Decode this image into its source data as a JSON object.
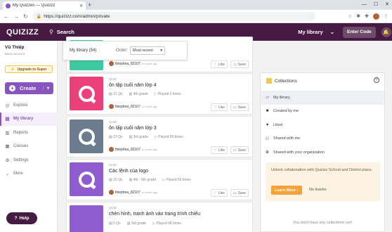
{
  "browser": {
    "tab_title": "My Quizzes — Quizizz",
    "tab_close": "✕",
    "new_tab": "+",
    "controls": [
      "—",
      "☐",
      "✕"
    ],
    "url": "https://quizizz.com/admin/private",
    "nav": [
      "←",
      "→",
      "↻"
    ]
  },
  "app": {
    "logo": "QUIZIZZ",
    "search_label": "Search",
    "library_label": "My library",
    "enter_code": "Enter Code",
    "brand_color": "#461a42",
    "accent_color": "#8854c0"
  },
  "sidebar": {
    "user_name": "Vũ Thiệp",
    "account_type": "Basic account",
    "upgrade_label": "Upgrade to Super",
    "create_label": "Create",
    "items": [
      {
        "label": "Explore",
        "icon": "compass-icon",
        "active": false
      },
      {
        "label": "My library",
        "icon": "library-icon",
        "active": true
      },
      {
        "label": "Reports",
        "icon": "reports-icon",
        "active": false
      },
      {
        "label": "Classes",
        "icon": "classes-icon",
        "active": false
      },
      {
        "label": "Settings",
        "icon": "gear-icon",
        "active": false
      },
      {
        "label": "More",
        "icon": "chevron-down-icon",
        "active": false
      }
    ],
    "help_label": "Help"
  },
  "filter": {
    "count_label": "My library (54)",
    "order_label": "Order:",
    "order_value": "Most recent"
  },
  "quizzes": [
    {
      "type": "",
      "title": "",
      "questions": "",
      "grade": "",
      "played": "",
      "owner": "thiepbna_82107",
      "ago": "a month ago",
      "color": "#3ec9a0"
    },
    {
      "type": "QUIZ",
      "title": "ôn tập cuối năm lớp 4",
      "questions": "21 Qs",
      "grade": "4th grade",
      "played": "Played 0 times",
      "owner": "thiepbna_82107",
      "ago": "a month ago",
      "color": "#ec407a"
    },
    {
      "type": "QUIZ",
      "title": "ôn tập cuối năm lớp 3",
      "questions": "23 Qs",
      "grade": "3rd grade",
      "played": "Played 80 times",
      "owner": "thiepbna_82107",
      "ago": "a month ago",
      "color": "#6d7b8f"
    },
    {
      "type": "QUIZ",
      "title": "Các lệnh của logo",
      "questions": "16 Qs",
      "grade": "4th - 5th grade",
      "played": "Played 56 times",
      "owner": "thiepbna_82107",
      "ago": "a month ago",
      "color": "#8e5ccf"
    },
    {
      "type": "QUIZ",
      "title": "chèn hình, tranh ảnh vào trang trình chiếu",
      "questions": "5 Qs",
      "grade": "3rd grade",
      "played": "Played 48 times",
      "owner": "",
      "ago": "",
      "color": "#8e5ccf"
    }
  ],
  "actions": {
    "like": "Like",
    "save": "Save"
  },
  "collections": {
    "title": "Collections",
    "items": [
      {
        "label": "My library",
        "icon": "folder-open-icon",
        "active": true
      },
      {
        "label": "Created by me",
        "icon": "folder-icon",
        "active": false
      },
      {
        "label": "Liked",
        "icon": "heart-icon",
        "active": false
      },
      {
        "label": "Shared with me",
        "icon": "users-icon",
        "active": false
      },
      {
        "label": "Shared with your organization",
        "icon": "globe-icon",
        "active": false
      }
    ],
    "promo_text": "Unlock collaboration with Quizizz School and District plans.",
    "learn_more": "Learn More",
    "no_thanks": "No thanks",
    "empty_text": "You don't have any collections yet!"
  }
}
